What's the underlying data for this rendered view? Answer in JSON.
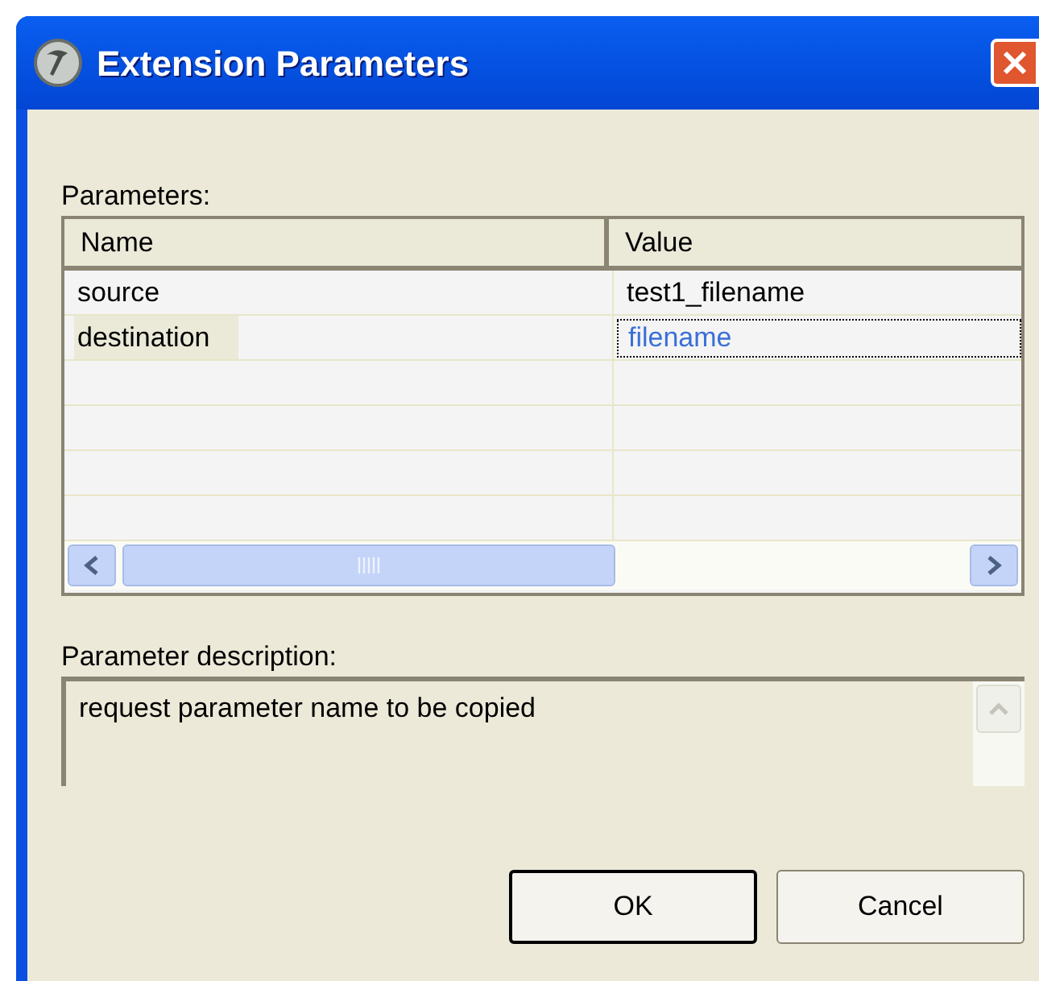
{
  "window": {
    "title": "Extension Parameters"
  },
  "parameters": {
    "label": "Parameters:",
    "columns": [
      "Name",
      "Value"
    ],
    "rows": [
      {
        "name": "source",
        "value": "test1_filename",
        "selected": false
      },
      {
        "name": "destination",
        "value": "filename",
        "selected": true
      }
    ]
  },
  "description": {
    "label": "Parameter description:",
    "text": "request parameter name to be copied"
  },
  "buttons": [
    {
      "label": "OK",
      "default": true
    },
    {
      "label": "Cancel",
      "default": false
    }
  ]
}
